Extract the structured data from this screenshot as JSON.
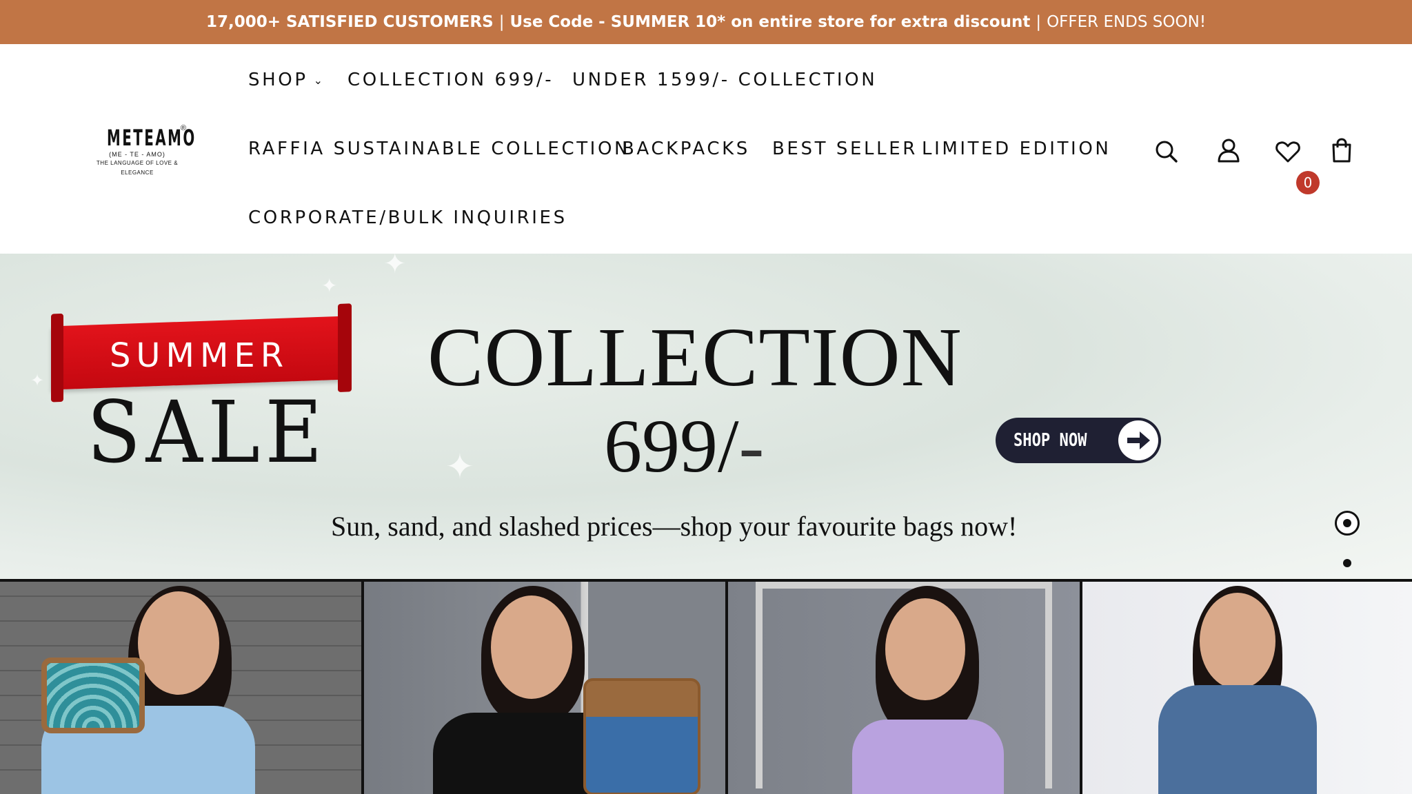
{
  "announcement": {
    "part1": "17,000+ SATISFIED CUSTOMERS",
    "sep1": "|",
    "part2": "Use Code - SUMMER 10* on entire store for extra discount",
    "sep2": "|",
    "part3": "OFFER ENDS SOON!"
  },
  "logo": {
    "brand": "METEAMO",
    "reg": "®",
    "sub": "(ME - TE - AMO)",
    "tagline": "THE LANGUAGE OF LOVE & ELEGANCE"
  },
  "nav": {
    "shop": "SHOP",
    "collection_699": "COLLECTION 699/-",
    "under_1599": "UNDER 1599/- COLLECTION",
    "raffia": "RAFFIA SUSTAINABLE COLLECTION",
    "backpacks": "BACKPACKS",
    "best_seller": "BEST SELLER",
    "limited_edition": "LIMITED EDITION",
    "corporate": "CORPORATE/BULK INQUIRIES"
  },
  "header_icons": {
    "search": "search-icon",
    "account": "user-icon",
    "wishlist": "heart-icon",
    "wishlist_count": "0",
    "cart": "shopping-bag-icon"
  },
  "hero": {
    "ribbon": "SUMMER",
    "sale": "SALE",
    "collection": "COLLECTION",
    "price": "699/",
    "price_suffix": "-",
    "cta": "SHOP NOW",
    "tagline": "Sun, sand, and slashed prices—shop your favourite bags now!",
    "slides_total": 4,
    "active_slide": 1
  },
  "colors": {
    "announcement_bg": "#c17545",
    "ribbon_red": "#d9101a",
    "cta_bg": "#1f2033",
    "badge": "#c0392b"
  }
}
